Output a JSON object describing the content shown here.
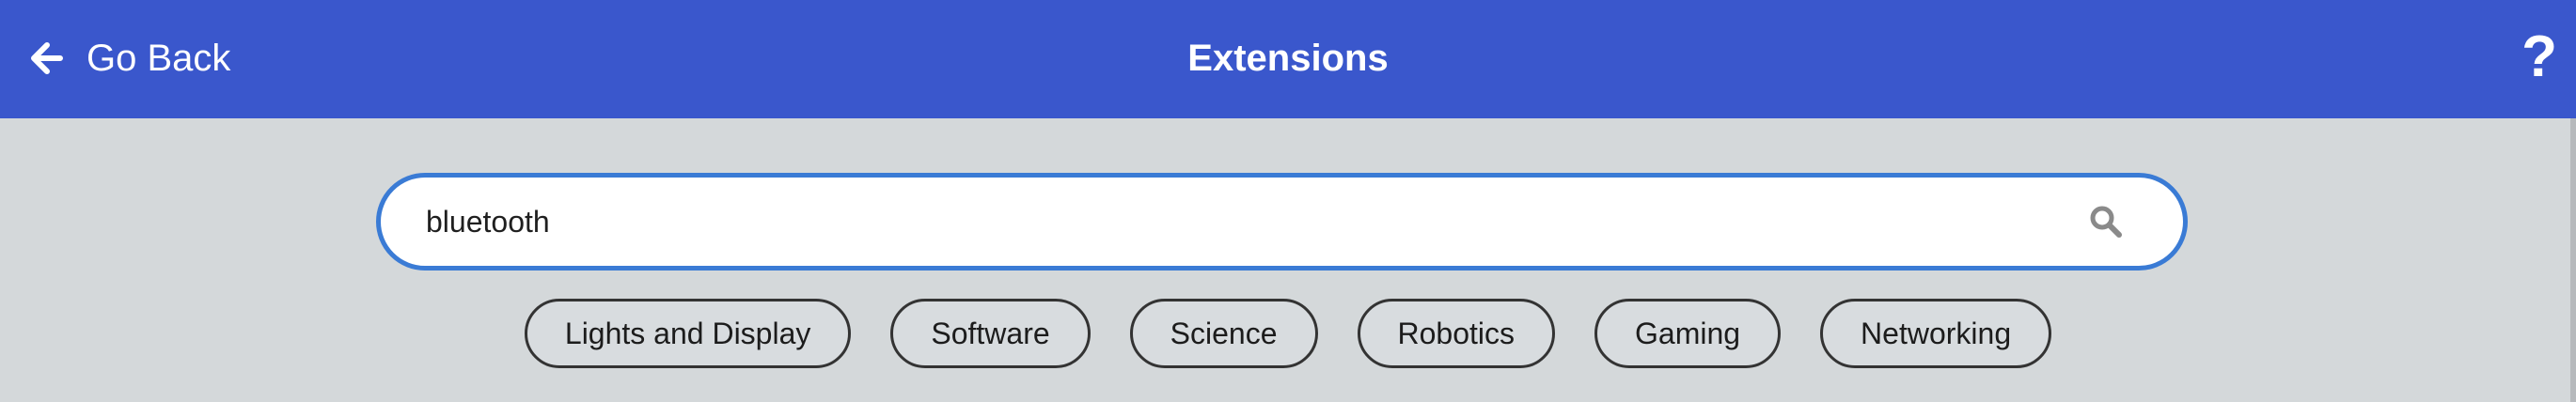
{
  "header": {
    "back_label": "Go Back",
    "title": "Extensions",
    "help_label": "?"
  },
  "search": {
    "value": "bluetooth",
    "placeholder": ""
  },
  "tags": [
    "Lights and Display",
    "Software",
    "Science",
    "Robotics",
    "Gaming",
    "Networking"
  ],
  "icons": {
    "back": "arrow-left-icon",
    "search": "search-icon",
    "help": "question-mark"
  },
  "colors": {
    "header": "#3a57cc",
    "background": "#d4d8da",
    "search_border": "#3a7bd5",
    "tag_border": "#333333"
  }
}
